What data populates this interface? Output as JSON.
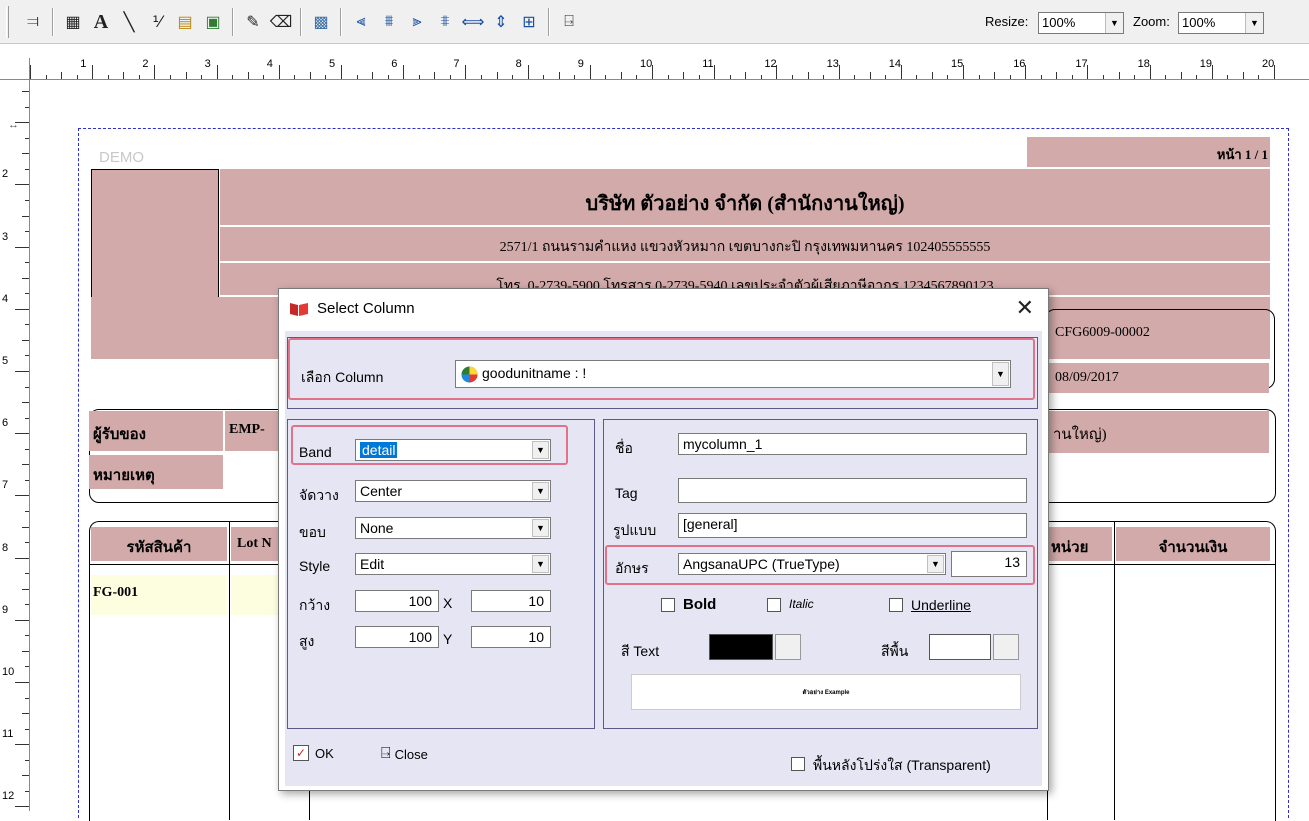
{
  "toolbar": {
    "resize_label": "Resize:",
    "resize_value": "100%",
    "zoom_label": "Zoom:",
    "zoom_value": "100%"
  },
  "ruler": {
    "h_numbers": [
      "1",
      "2",
      "3",
      "4",
      "5",
      "6",
      "7",
      "8",
      "9",
      "10",
      "11",
      "12",
      "13",
      "14",
      "15",
      "16",
      "17",
      "18",
      "19",
      "20"
    ],
    "v_numbers": [
      "2",
      "3",
      "4",
      "5",
      "6",
      "7",
      "8",
      "9",
      "10",
      "11",
      "12"
    ]
  },
  "report": {
    "demo": "DEMO",
    "page_label": "หน้า 1 / 1",
    "company": "บริษัท ตัวอย่าง จำกัด   (สำนักงานใหญ่)",
    "address": "2571/1 ถนนรามคำแหง แขวงหัวหมาก เขตบางกะปิ กรุงเทพมหานคร 102405555555",
    "phone": "โทร. 0-2739-5900   โทรสาร 0-2739-5940   เลขประจำตัวผู้เสียภาษีอากร 1234567890123",
    "doc_no": "CFG6009-00002",
    "doc_date": "08/09/2017",
    "receiver_label": "ผู้รับของ",
    "receiver_value": "EMP-",
    "branch_text": "านใหญ่)",
    "remark_label": "หมายเหตุ",
    "columns": {
      "product_code": "รหัสสินค้า",
      "lot": "Lot N",
      "unit": "หน่วย",
      "amount": "จำนวนเงิน"
    },
    "row1_code": "FG-001"
  },
  "dialog": {
    "title": "Select Column",
    "column_label": "เลือก Column",
    "column_value": "goodunitname : !",
    "band_label": "Band",
    "band_value": "detail",
    "align_label": "จัดวาง",
    "align_value": "Center",
    "border_label": "ขอบ",
    "border_value": "None",
    "style_label": "Style",
    "style_value": "Edit",
    "width_label": "กว้าง",
    "width_value": "100",
    "x_label": "X",
    "x_value": "10",
    "height_label": "สูง",
    "height_value": "100",
    "y_label": "Y",
    "y_value": "10",
    "name_label": "ชื่อ",
    "name_value": "mycolumn_1",
    "tag_label": "Tag",
    "tag_value": "",
    "format_label": "รูปแบบ",
    "format_value": "[general]",
    "font_label": "อักษร",
    "font_value": "AngsanaUPC (TrueType)",
    "font_size": "13",
    "bold_label": "Bold",
    "italic_label": "Italic",
    "underline_label": "Underline",
    "text_color_label": "สี Text",
    "bg_color_label": "สีพื้น",
    "sample_text": "ตัวอย่าง Example",
    "ok_label": "OK",
    "close_label": "Close",
    "transparent_label": "พื้นหลังโปร่งใส (Transparent)"
  },
  "colors": {
    "report_pink": "#d3aaaa",
    "dialog_bg": "#e6e5f3",
    "highlight": "#e0738a",
    "selection": "#0078d7",
    "text_color": "#000000",
    "bg_color": "#ffffff"
  }
}
